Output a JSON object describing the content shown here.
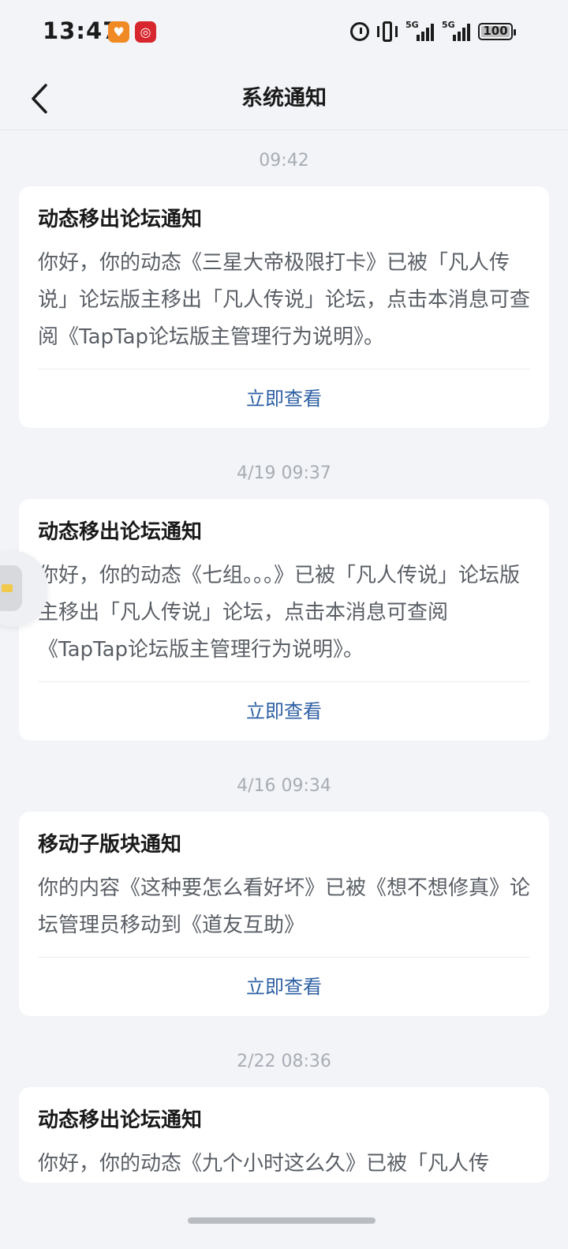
{
  "status_bar": {
    "time": "13:47",
    "signal_1_label": "5G",
    "signal_2_label": "5G",
    "battery": "100"
  },
  "header": {
    "title": "系统通知"
  },
  "notifications": [
    {
      "time": "09:42",
      "title": "动态移出论坛通知",
      "body": "你好，你的动态《三星大帝极限打卡》已被「凡人传说」论坛版主移出「凡人传说」论坛，点击本消息可查阅《TapTap论坛版主管理行为说明》。",
      "action": "立即查看"
    },
    {
      "time": "4/19  09:37",
      "title": "动态移出论坛通知",
      "body": "你好，你的动态《七组。。。》已被「凡人传说」论坛版主移出「凡人传说」论坛，点击本消息可查阅《TapTap论坛版主管理行为说明》。",
      "action": "立即查看"
    },
    {
      "time": "4/16  09:34",
      "title": "移动子版块通知",
      "body": "你的内容《这种要怎么看好坏》已被《想不想修真》论坛管理员移动到《道友互助》",
      "action": "立即查看"
    },
    {
      "time": "2/22  08:36",
      "title": "动态移出论坛通知",
      "body": "你好，你的动态《九个小时这么久》已被「凡人传"
    }
  ]
}
